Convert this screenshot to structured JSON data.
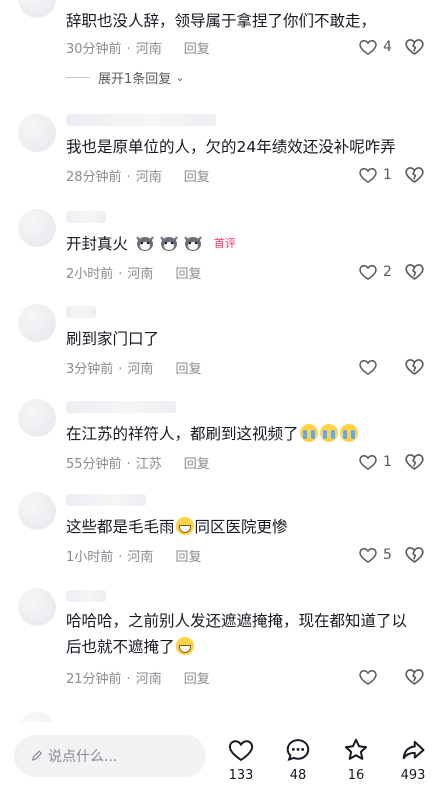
{
  "comments": [
    {
      "text": "辞职也没人辞，领导属于拿捏了你们不敢走，",
      "time": "30分钟前",
      "location": "河南",
      "reply": "回复",
      "likes": "4",
      "expand_label": "展开1条回复"
    },
    {
      "text": "我也是原单位的人，欠的24年绩效还没补呢咋弄",
      "time": "28分钟前",
      "location": "河南",
      "reply": "回复",
      "likes": "1"
    },
    {
      "text": "开封真火",
      "badge": "首评",
      "time": "2小时前",
      "location": "河南",
      "reply": "回复",
      "likes": "2"
    },
    {
      "text": "刷到家门口了",
      "time": "3分钟前",
      "location": "河南",
      "reply": "回复",
      "likes": ""
    },
    {
      "text": "在江苏的祥符人，都刷到这视频了",
      "time": "55分钟前",
      "location": "江苏",
      "reply": "回复",
      "likes": "1"
    },
    {
      "text_before": "这些都是毛毛雨",
      "text_after": "同区医院更惨",
      "time": "1小时前",
      "location": "河南",
      "reply": "回复",
      "likes": "5"
    },
    {
      "text_line1": "哈哈哈，之前别人发还遮遮掩掩，现在都知道了以",
      "text_line2": "后也就不遮掩了",
      "time": "21分钟前",
      "location": "河南",
      "reply": "回复",
      "likes": ""
    }
  ],
  "bottom_bar": {
    "input_placeholder": "说点什么...",
    "like_count": "133",
    "comment_count": "48",
    "favorite_count": "16",
    "share_count": "493"
  },
  "colors": {
    "text": "#161823",
    "meta": "#8a8b91",
    "accent": "#fe2c55"
  }
}
